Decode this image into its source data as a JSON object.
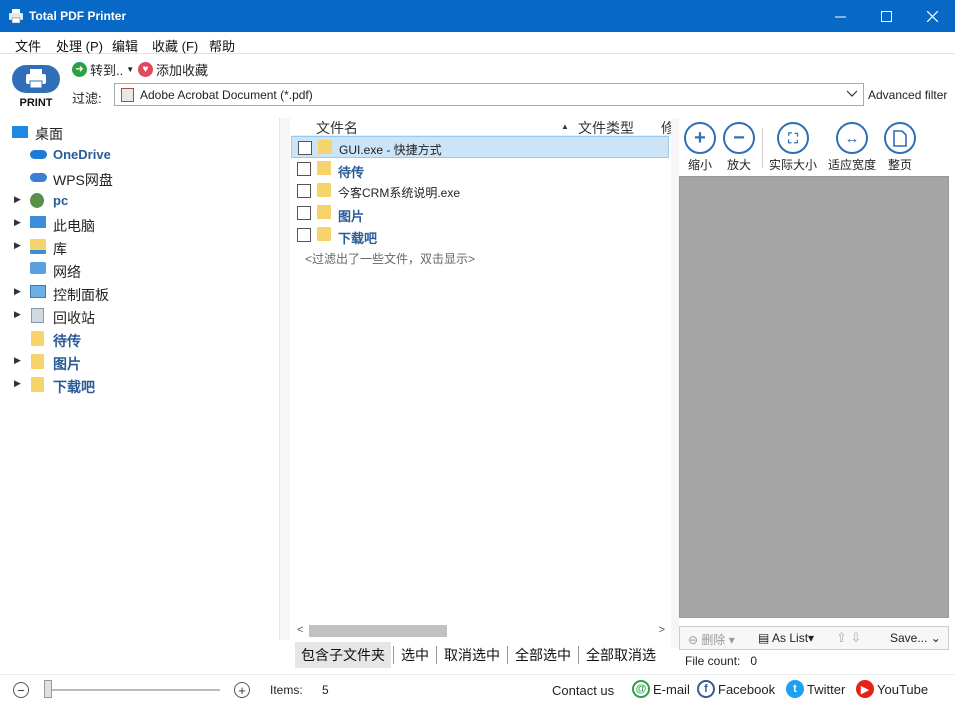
{
  "window": {
    "title": "Total PDF Printer"
  },
  "menu": [
    "文件",
    "处理 (P)",
    "编辑",
    "收藏 (F)",
    "帮助"
  ],
  "toolbar": {
    "print_label": "PRINT",
    "goto_label": "转到..",
    "fav_label": "添加收藏",
    "filter_label": "过滤:",
    "filter_value": "Adobe Acrobat Document (*.pdf)",
    "advanced_filter": "Advanced filter"
  },
  "tree": [
    {
      "label": "桌面"
    },
    {
      "label": "OneDrive"
    },
    {
      "label": "WPS网盘"
    },
    {
      "label": "pc"
    },
    {
      "label": "此电脑"
    },
    {
      "label": "库"
    },
    {
      "label": "网络"
    },
    {
      "label": "控制面板"
    },
    {
      "label": "回收站"
    },
    {
      "label": "待传"
    },
    {
      "label": "图片"
    },
    {
      "label": "下载吧"
    }
  ],
  "filelist": {
    "columns": [
      "文件名",
      "文件类型",
      "修"
    ],
    "rows": [
      {
        "name": "GUI.exe - 快捷方式"
      },
      {
        "name": "待传"
      },
      {
        "name": "今客CRM系统说明.exe"
      },
      {
        "name": "图片"
      },
      {
        "name": "下载吧"
      }
    ],
    "filtered_note": "<过滤出了一些文件，双击显示>",
    "actions": [
      "包含子文件夹",
      "选中",
      "取消选中",
      "全部选中",
      "全部取消选"
    ]
  },
  "preview": {
    "tools": [
      "缩小",
      "放大",
      "实际大小",
      "适应宽度",
      "整页"
    ],
    "delete_label": "删除",
    "as_list_label": "As List",
    "save_label": "Save...",
    "file_count_label": "File count:",
    "file_count_value": "0"
  },
  "status": {
    "items_label": "Items:",
    "items_value": "5",
    "contact": "Contact us",
    "email": "E-mail",
    "facebook": "Facebook",
    "twitter": "Twitter",
    "youtube": "YouTube"
  },
  "colors": {
    "titlebar": "#0868c6",
    "accent": "#2f6fb7",
    "selected_row": "#cce4f7",
    "folder": "#f6d36b"
  }
}
